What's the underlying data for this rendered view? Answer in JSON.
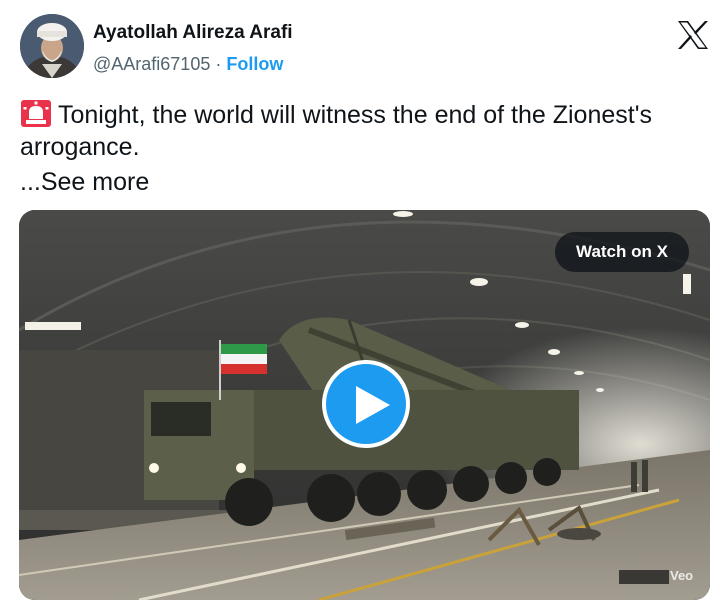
{
  "author": {
    "name": "Ayatollah Alireza Arafi",
    "handle": "@AArafi67105",
    "separator": "·",
    "follow_label": "Follow"
  },
  "header": {
    "logo_icon": "x-logo-icon"
  },
  "tweet": {
    "text": "Tonight, the world will witness the end of the Zionest's arrogance.",
    "emoji_icon": "rotating-light-icon",
    "see_more_label": "...See more"
  },
  "media": {
    "watch_label": "Watch on X",
    "play_icon": "play-icon",
    "watermark": "Veo"
  },
  "colors": {
    "accent": "#1d9bf0",
    "text": "#0f1419",
    "secondary_text": "#536471"
  }
}
